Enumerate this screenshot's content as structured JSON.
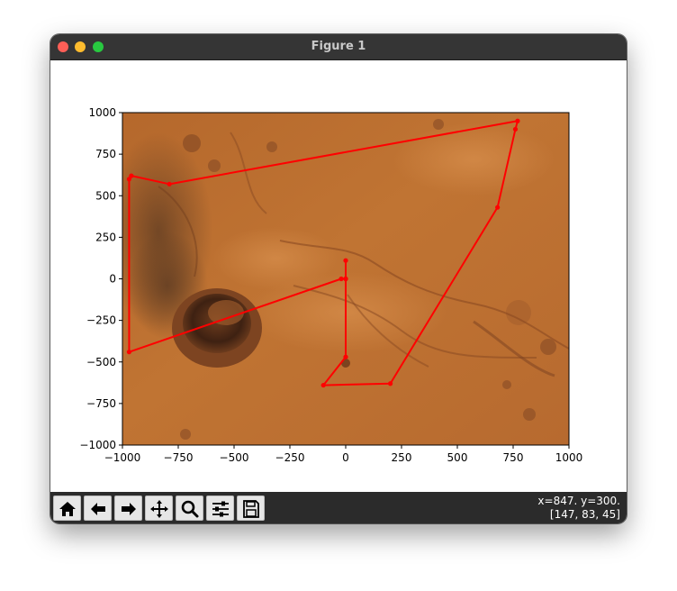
{
  "window": {
    "title": "Figure 1",
    "colors": {
      "titlebar": "#353535",
      "toolbar": "#2b2b2b",
      "close": "#fe5f57",
      "minimize": "#febc2e",
      "maximize": "#28c840"
    }
  },
  "toolbar": {
    "buttons": [
      {
        "name": "home",
        "icon": "home-icon"
      },
      {
        "name": "back",
        "icon": "arrow-left-icon"
      },
      {
        "name": "forward",
        "icon": "arrow-right-icon"
      },
      {
        "name": "pan",
        "icon": "move-icon"
      },
      {
        "name": "zoom",
        "icon": "zoom-icon"
      },
      {
        "name": "configure-subplots",
        "icon": "sliders-icon"
      },
      {
        "name": "save",
        "icon": "save-icon"
      }
    ],
    "coords_line1": "x=847. y=300.",
    "coords_line2": "[147, 83, 45]"
  },
  "chart_data": {
    "type": "line",
    "background": "terrain image (orange-brown cratered landscape)",
    "xlim": [
      -1000,
      1000
    ],
    "ylim": [
      -1000,
      1000
    ],
    "xticks": [
      -1000,
      -750,
      -500,
      -250,
      0,
      250,
      500,
      750,
      1000
    ],
    "yticks": [
      -1000,
      -750,
      -500,
      -250,
      0,
      250,
      500,
      750,
      1000
    ],
    "xtick_labels": [
      "−1000",
      "−750",
      "−500",
      "−250",
      "0",
      "250",
      "500",
      "750",
      "1000"
    ],
    "ytick_labels": [
      "−1000",
      "−750",
      "−500",
      "−250",
      "0",
      "250",
      "500",
      "750",
      "1000"
    ],
    "grid": false,
    "series": [
      {
        "color": "#ff0000",
        "marker": "circle",
        "x": [
          0,
          0,
          0,
          -100,
          200,
          680,
          760,
          770,
          -790,
          -960,
          -970,
          -970,
          -20,
          0
        ],
        "y": [
          110,
          0,
          -470,
          -640,
          -630,
          430,
          900,
          950,
          570,
          620,
          600,
          -440,
          0,
          0
        ]
      }
    ]
  }
}
